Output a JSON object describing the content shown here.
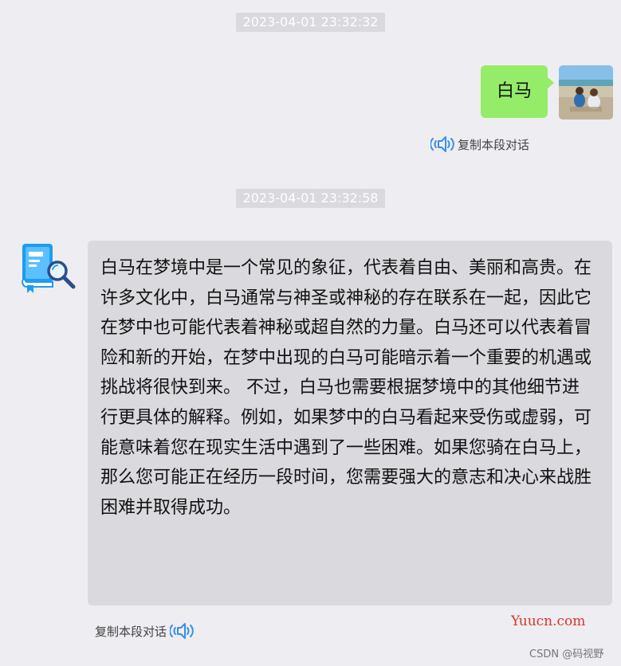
{
  "chat": {
    "messages": [
      {
        "timestamp": "2023-04-01 23:32:32",
        "sender": "user",
        "text": "白马",
        "action_label": "复制本段对话"
      },
      {
        "timestamp": "2023-04-01 23:32:58",
        "sender": "bot",
        "text": "白马在梦境中是一个常见的象征，代表着自由、美丽和高贵。在许多文化中，白马通常与神圣或神秘的存在联系在一起，因此它在梦中也可能代表着神秘或超自然的力量。白马还可以代表着冒险和新的开始，在梦中出现的白马可能暗示着一个重要的机遇或挑战将很快到来。 不过，白马也需要根据梦境中的其他细节进行更具体的解释。例如，如果梦中的白马看起来受伤或虚弱，可能意味着您在现实生活中遇到了一些困难。如果您骑在白马上，那么您可能正在经历一段时间，您需要强大的意志和决心来战胜困难并取得成功。",
        "action_label": "复制本段对话"
      }
    ]
  },
  "watermarks": {
    "site": "Yuucn.com",
    "csdn": "CSDN @码视野"
  },
  "colors": {
    "background": "#ededf2",
    "user_bubble": "#95ec69",
    "bot_bubble": "#d9d9de",
    "timestamp_badge": "#d9d9de",
    "speaker_icon": "#3a8ee6",
    "bot_avatar_primary": "#1e9cf0",
    "watermark_site": "#d9342b"
  },
  "icons": {
    "user_avatar": "user-photo-avatar",
    "bot_avatar": "book-search-icon",
    "speaker": "speaker-icon"
  }
}
